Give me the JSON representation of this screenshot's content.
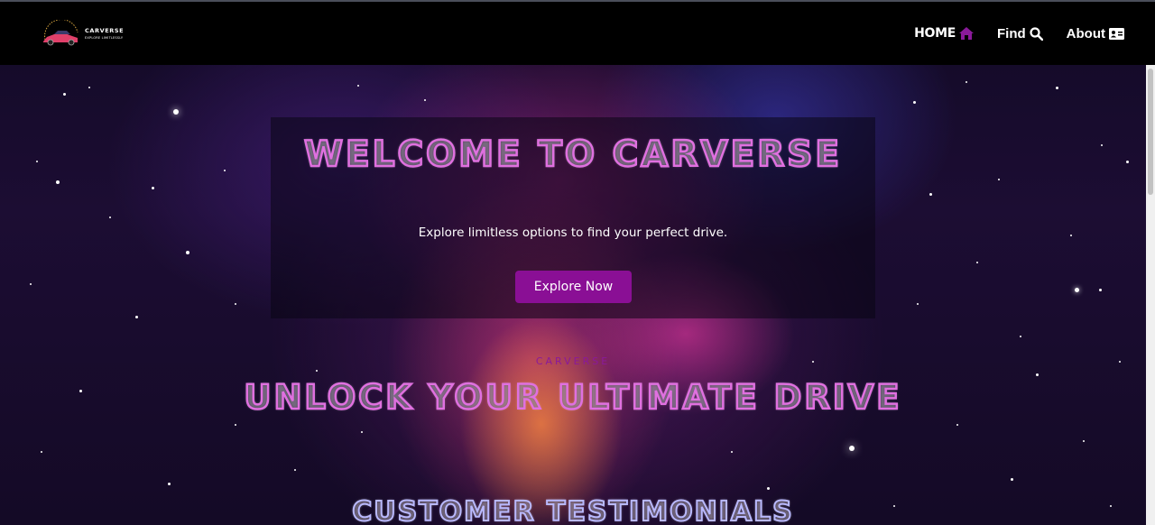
{
  "brand": {
    "name": "CARVERSE",
    "tagline": "EXPLORE LIMITLESSLY"
  },
  "nav": {
    "items": [
      {
        "label": "HOME",
        "icon": "home-icon"
      },
      {
        "label": "Find",
        "icon": "search-icon"
      },
      {
        "label": "About",
        "icon": "id-card-icon"
      }
    ],
    "active_color": "#8a1a9a"
  },
  "hero": {
    "title": "WELCOME TO CARVERSE",
    "subtitle": "Explore limitless options to find your perfect drive.",
    "cta_label": "Explore Now",
    "cta_color": "#8a0f95"
  },
  "section": {
    "kicker": "CARVERSE",
    "title": "UNLOCK YOUR ULTIMATE DRIVE"
  },
  "testimonials": {
    "title": "CUSTOMER TESTIMONIALS"
  },
  "theme": {
    "outline_color": "#e070e0",
    "navbar_bg": "#000000"
  }
}
